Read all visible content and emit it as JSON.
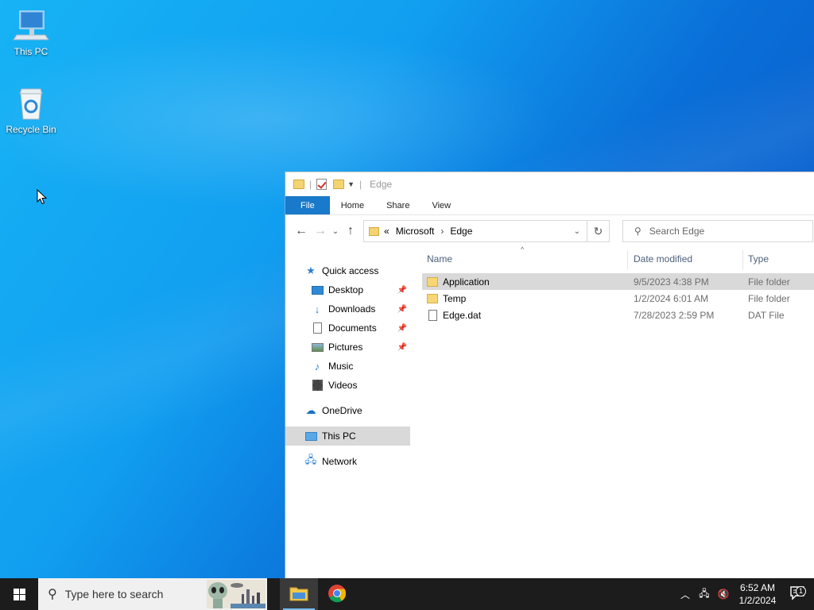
{
  "desktop": {
    "icons": [
      {
        "label": "This PC"
      },
      {
        "label": "Recycle Bin"
      }
    ]
  },
  "explorer": {
    "title": "Edge",
    "ribbon_tabs": [
      "File",
      "Home",
      "Share",
      "View"
    ],
    "address": {
      "overflow": "«",
      "crumbs": [
        "Microsoft",
        "Edge"
      ]
    },
    "search_placeholder": "Search Edge",
    "nav": {
      "quick_access": "Quick access",
      "quick_items": [
        "Desktop",
        "Downloads",
        "Documents",
        "Pictures",
        "Music",
        "Videos"
      ],
      "onedrive": "OneDrive",
      "this_pc": "This PC",
      "network": "Network"
    },
    "columns": {
      "name": "Name",
      "date": "Date modified",
      "type": "Type"
    },
    "files": [
      {
        "name": "Application",
        "date": "9/5/2023 4:38 PM",
        "type": "File folder",
        "kind": "folder",
        "selected": true
      },
      {
        "name": "Temp",
        "date": "1/2/2024 6:01 AM",
        "type": "File folder",
        "kind": "folder",
        "selected": false
      },
      {
        "name": "Edge.dat",
        "date": "7/28/2023 2:59 PM",
        "type": "DAT File",
        "kind": "file",
        "selected": false
      }
    ]
  },
  "taskbar": {
    "search_placeholder": "Type here to search",
    "clock_time": "6:52 AM",
    "clock_date": "1/2/2024",
    "notification_count": "1"
  },
  "colors": {
    "file_tab": "#1979ca",
    "selection": "#d9d9d9",
    "taskbar": "#1c1c1c"
  }
}
